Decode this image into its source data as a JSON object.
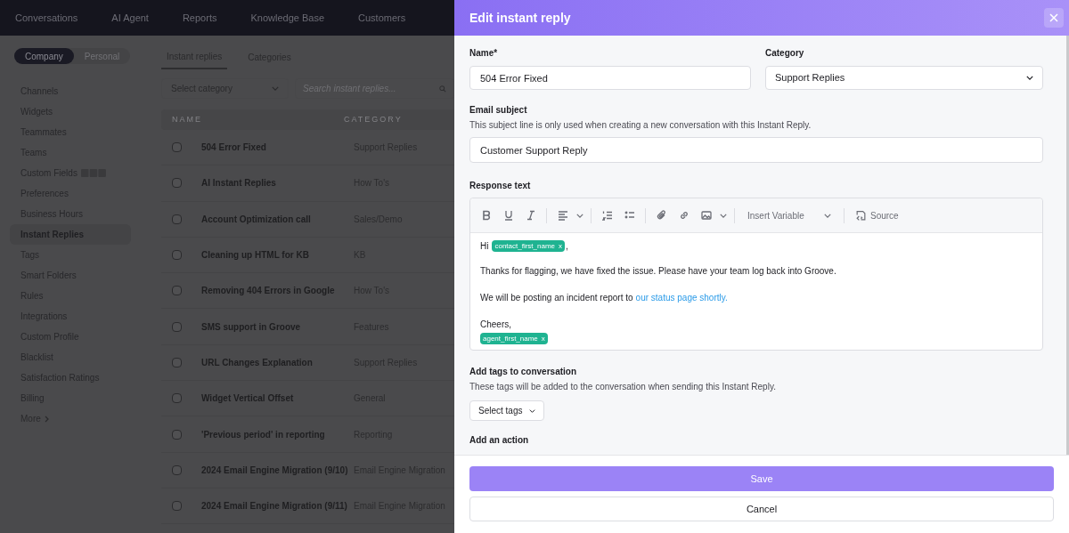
{
  "top_nav": [
    "Conversations",
    "AI Agent",
    "Reports",
    "Knowledge Base",
    "Customers"
  ],
  "scope_toggle": [
    {
      "label": "Company",
      "selected": true
    },
    {
      "label": "Personal",
      "selected": false
    }
  ],
  "sidebar": {
    "items": [
      {
        "label": "Channels",
        "selected": false
      },
      {
        "label": "Widgets",
        "selected": false
      },
      {
        "label": "Teammates",
        "selected": false
      },
      {
        "label": "Teams",
        "selected": false
      },
      {
        "label": "Custom Fields",
        "selected": false,
        "badge": true
      },
      {
        "label": "Preferences",
        "selected": false
      },
      {
        "label": "Business Hours",
        "selected": false
      },
      {
        "label": "Instant Replies",
        "selected": true
      },
      {
        "label": "Tags",
        "selected": false
      },
      {
        "label": "Smart Folders",
        "selected": false
      },
      {
        "label": "Rules",
        "selected": false
      },
      {
        "label": "Integrations",
        "selected": false
      },
      {
        "label": "Custom Profile",
        "selected": false
      },
      {
        "label": "Blacklist",
        "selected": false
      },
      {
        "label": "Satisfaction Ratings",
        "selected": false
      },
      {
        "label": "Billing",
        "selected": false
      }
    ],
    "more": "More"
  },
  "tabs": [
    {
      "label": "Instant replies",
      "selected": true
    },
    {
      "label": "Categories",
      "selected": false
    }
  ],
  "filter": {
    "category_placeholder": "Select category",
    "search_placeholder": "Search instant replies..."
  },
  "table": {
    "columns": [
      "NAME",
      "CATEGORY"
    ],
    "rows": [
      {
        "checked": false,
        "name": "504 Error Fixed",
        "category": "Support Replies"
      },
      {
        "checked": false,
        "name": "AI Instant Replies",
        "category": "How To's"
      },
      {
        "checked": false,
        "name": "Account Optimization call",
        "category": "Sales/Demo"
      },
      {
        "checked": false,
        "name": "Cleaning up HTML for KB",
        "category": "KB"
      },
      {
        "checked": false,
        "name": "Removing 404 Errors in Google",
        "category": "How To's"
      },
      {
        "checked": false,
        "name": "SMS support in Groove",
        "category": "Features"
      },
      {
        "checked": false,
        "name": "URL Changes Explanation",
        "category": "Support Replies"
      },
      {
        "checked": false,
        "name": "Widget Vertical Offset",
        "category": "General"
      },
      {
        "checked": false,
        "name": "'Previous period' in reporting",
        "category": "Reporting"
      },
      {
        "checked": false,
        "name": "2024 Email Engine Migration (9/10)",
        "category": "Email Engine Migration"
      },
      {
        "checked": false,
        "name": "2024 Email Engine Migration (9/11)",
        "category": "Email Engine Migration"
      }
    ]
  },
  "dialog": {
    "title": "Edit instant reply",
    "name": {
      "label": "Name*",
      "value": "504 Error Fixed"
    },
    "category": {
      "label": "Category",
      "value": "Support Replies"
    },
    "email_subject": {
      "label": "Email subject",
      "hint": "This subject line is only used when creating a new conversation with this Instant Reply.",
      "value": "Customer Support Reply"
    },
    "response": {
      "label": "Response text",
      "insert_variable": "Insert Variable",
      "source": "Source",
      "greeting": "Hi",
      "greeting_variable": "contact_first_name",
      "greeting_end": ",",
      "paragraph_1": "Thanks for flagging, we have fixed the issue. Please have your team log back into Groove.",
      "paragraph_2": "We will be posting an incident report to",
      "link": "our status page shortly.",
      "signoff": "Cheers,",
      "signature_variable": "agent_first_name",
      "greeting_remove_mark": "x",
      "signature_remove_mark": "x"
    },
    "tags": {
      "label": "Add tags to conversation",
      "hint": "These tags will be added to the conversation when sending this Instant Reply.",
      "button": "Select tags"
    },
    "action": {
      "label": "Add an action"
    },
    "save": "Save",
    "cancel": "Cancel"
  }
}
